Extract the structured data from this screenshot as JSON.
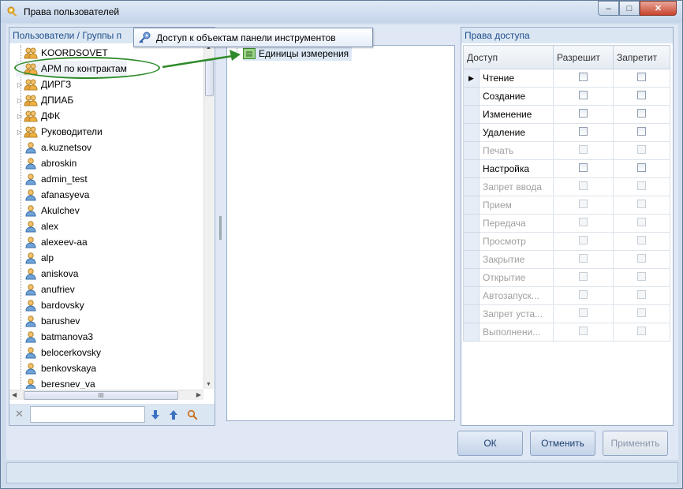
{
  "window": {
    "title": "Права пользователей",
    "controls": {
      "minimize": "–",
      "maximize": "□",
      "close": "✕"
    }
  },
  "left_panel": {
    "header": "Пользователи / Группы п",
    "tree": [
      {
        "label": "KOORDSOVET",
        "type": "group",
        "expandable": false
      },
      {
        "label": "АРМ по контрактам",
        "type": "group",
        "expandable": false,
        "selected": true
      },
      {
        "label": "ДИРГЗ",
        "type": "group",
        "expandable": true
      },
      {
        "label": "ДПИАБ",
        "type": "group",
        "expandable": true
      },
      {
        "label": "ДФК",
        "type": "group",
        "expandable": true
      },
      {
        "label": "Руководители",
        "type": "group",
        "expandable": true
      },
      {
        "label": "a.kuznetsov",
        "type": "user"
      },
      {
        "label": "abroskin",
        "type": "user"
      },
      {
        "label": "admin_test",
        "type": "user"
      },
      {
        "label": "afanasyeva",
        "type": "user"
      },
      {
        "label": "Akulchev",
        "type": "user"
      },
      {
        "label": "alex",
        "type": "user"
      },
      {
        "label": "alexeev-aa",
        "type": "user"
      },
      {
        "label": "alp",
        "type": "user"
      },
      {
        "label": "aniskova",
        "type": "user"
      },
      {
        "label": "anufriev",
        "type": "user"
      },
      {
        "label": "bardovsky",
        "type": "user"
      },
      {
        "label": "barushev",
        "type": "user"
      },
      {
        "label": "batmanova3",
        "type": "user"
      },
      {
        "label": "belocerkovsky",
        "type": "user"
      },
      {
        "label": "benkovskaya",
        "type": "user"
      },
      {
        "label": "beresnev_va",
        "type": "user"
      }
    ],
    "hscroll_grip": "III",
    "search": {
      "clear": "✕",
      "value": "",
      "down_icon": "arrow-down-icon",
      "up_icon": "arrow-up-icon",
      "find_icon": "magnifier-icon"
    }
  },
  "middle_panel": {
    "tooltip": "Доступ к объектам панели инструментов",
    "tree": [
      {
        "label": "Единицы измерения",
        "icon": "table-icon"
      }
    ]
  },
  "right_panel": {
    "header": "Права доступа",
    "columns": [
      "Доступ",
      "Разрешит",
      "Запретит"
    ],
    "rows": [
      {
        "label": "Чтение",
        "enabled": true,
        "current": true
      },
      {
        "label": "Создание",
        "enabled": true
      },
      {
        "label": "Изменение",
        "enabled": true
      },
      {
        "label": "Удаление",
        "enabled": true
      },
      {
        "label": "Печать",
        "enabled": false
      },
      {
        "label": "Настройка",
        "enabled": true
      },
      {
        "label": "Запрет ввода",
        "enabled": false
      },
      {
        "label": "Прием",
        "enabled": false
      },
      {
        "label": "Передача",
        "enabled": false
      },
      {
        "label": "Просмотр",
        "enabled": false
      },
      {
        "label": "Закрытие",
        "enabled": false
      },
      {
        "label": "Открытие",
        "enabled": false
      },
      {
        "label": "Автозапуск...",
        "enabled": false
      },
      {
        "label": "Запрет  уста...",
        "enabled": false
      },
      {
        "label": "Выполнени...",
        "enabled": false
      }
    ]
  },
  "buttons": {
    "ok": "ОК",
    "cancel": "Отменить",
    "apply": "Применить"
  },
  "colors": {
    "annotation": "#2e8a2a",
    "header_text": "#1f4e8c"
  }
}
